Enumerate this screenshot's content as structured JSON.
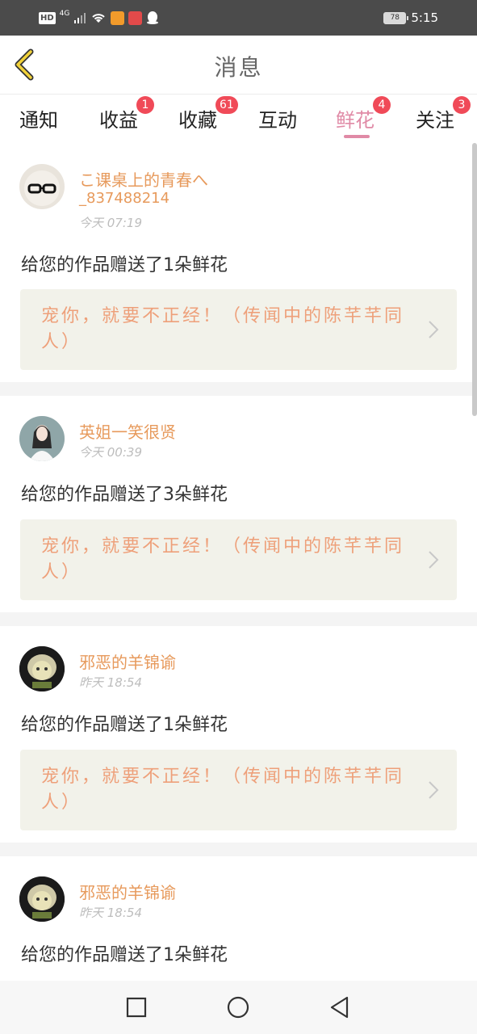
{
  "status_bar": {
    "hd": "HD",
    "signal": "4G",
    "battery": "78",
    "time": "5:15"
  },
  "header": {
    "title": "消息",
    "back_icon": "chevron-left-icon"
  },
  "tabs": [
    {
      "label": "通知",
      "badge": ""
    },
    {
      "label": "收益",
      "badge": "1"
    },
    {
      "label": "收藏",
      "badge": "61"
    },
    {
      "label": "互动",
      "badge": ""
    },
    {
      "label": "鲜花",
      "badge": "4",
      "active": true
    },
    {
      "label": "关注",
      "badge": "3"
    }
  ],
  "items": [
    {
      "name": "こ课桌上的青春へ",
      "id": "_837488214",
      "time": "今天 07:19",
      "message": "给您的作品赠送了1朵鲜花",
      "work": "宠你，就要不正经！（传闻中的陈芊芊同人）"
    },
    {
      "name": "英姐一笑很贤",
      "id": "",
      "time": "今天 00:39",
      "message": "给您的作品赠送了3朵鲜花",
      "work": "宠你，就要不正经！（传闻中的陈芊芊同人）"
    },
    {
      "name": "邪恶的羊锦谕",
      "id": "",
      "time": "昨天 18:54",
      "message": "给您的作品赠送了1朵鲜花",
      "work": "宠你，就要不正经！（传闻中的陈芊芊同人）"
    },
    {
      "name": "邪恶的羊锦谕",
      "id": "",
      "time": "昨天 18:54",
      "message": "给您的作品赠送了1朵鲜花",
      "work": ""
    }
  ],
  "colors": {
    "accent": "#e08aa6",
    "username": "#e79a5c",
    "work_title": "#eea07a",
    "badge": "#f04a58"
  }
}
